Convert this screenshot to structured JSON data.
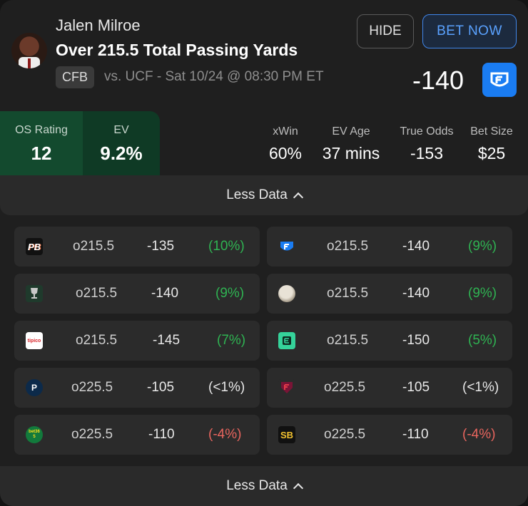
{
  "header": {
    "player_name": "Jalen Milroe",
    "market": "Over 215.5 Total Passing Yards",
    "league": "CFB",
    "matchup": "vs. UCF - Sat 10/24 @ 08:30 PM ET",
    "hide_label": "HIDE",
    "bet_label": "BET NOW",
    "odds": "-140"
  },
  "ratings": {
    "os_label": "OS Rating",
    "os_value": "12",
    "ev_label": "EV",
    "ev_value": "9.2%"
  },
  "metrics": [
    {
      "label": "xWin",
      "value": "60%"
    },
    {
      "label": "EV Age",
      "value": "37 mins"
    },
    {
      "label": "True Odds",
      "value": "-153"
    },
    {
      "label": "Bet Size",
      "value": "$25"
    }
  ],
  "less_data_label": "Less Data",
  "books": [
    {
      "logo": "pointsbet-icon",
      "line": "o215.5",
      "odds": "-135",
      "pct": "(10%)",
      "tone": "pos"
    },
    {
      "logo": "fanduel-icon",
      "line": "o215.5",
      "odds": "-140",
      "pct": "(9%)",
      "tone": "pos"
    },
    {
      "logo": "trophy-icon",
      "line": "o215.5",
      "odds": "-140",
      "pct": "(9%)",
      "tone": "pos"
    },
    {
      "logo": "betmgm-lion-icon",
      "line": "o215.5",
      "odds": "-140",
      "pct": "(9%)",
      "tone": "pos"
    },
    {
      "logo": "tipico-icon",
      "line": "o215.5",
      "odds": "-145",
      "pct": "(7%)",
      "tone": "pos"
    },
    {
      "logo": "espnbet-icon",
      "line": "o215.5",
      "odds": "-150",
      "pct": "(5%)",
      "tone": "pos"
    },
    {
      "logo": "pinnacle-icon",
      "line": "o225.5",
      "odds": "-105",
      "pct": "(<1%)",
      "tone": "neu"
    },
    {
      "logo": "fanatics-icon",
      "line": "o225.5",
      "odds": "-105",
      "pct": "(<1%)",
      "tone": "neu"
    },
    {
      "logo": "bet365-icon",
      "line": "o225.5",
      "odds": "-110",
      "pct": "(-4%)",
      "tone": "neg"
    },
    {
      "logo": "superbook-icon",
      "line": "o225.5",
      "odds": "-110",
      "pct": "(-4%)",
      "tone": "neg"
    }
  ],
  "book_text": {
    "pointsbet": "PB",
    "tipico": "tipico",
    "bet365": "bet365",
    "superbook": "SB"
  },
  "colors": {
    "accent": "#3f86ea",
    "positive": "#2fb352",
    "negative": "#e8655e",
    "rating_bg": "#134a2e"
  }
}
